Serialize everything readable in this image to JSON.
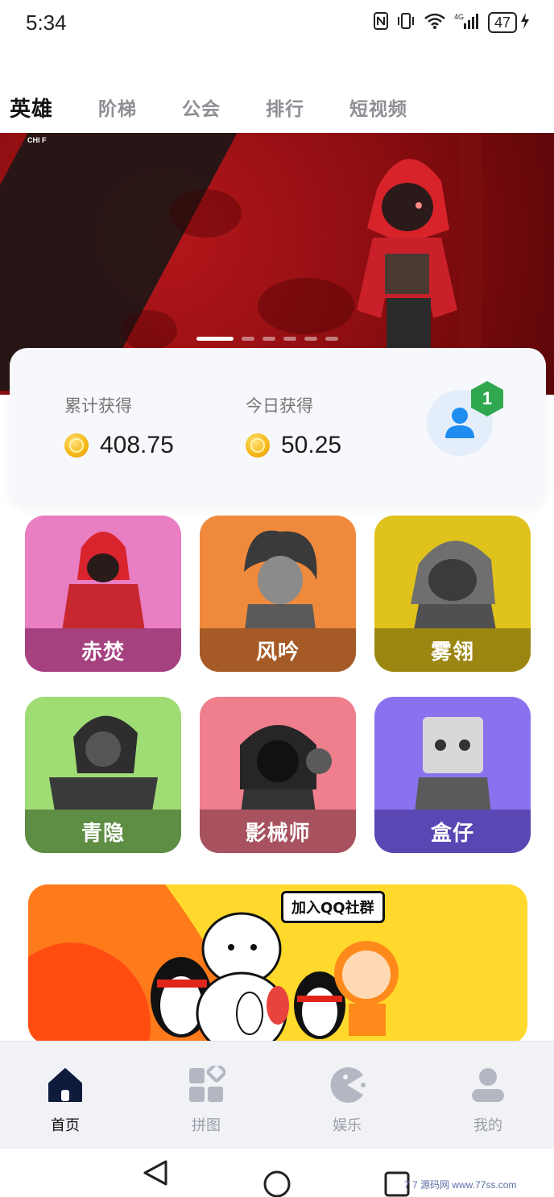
{
  "status_bar": {
    "time": "5:34",
    "battery": "47"
  },
  "top_tabs": [
    {
      "label": "英雄",
      "active": true
    },
    {
      "label": "阶梯",
      "active": false
    },
    {
      "label": "公会",
      "active": false
    },
    {
      "label": "排行",
      "active": false
    },
    {
      "label": "短视频",
      "active": false
    }
  ],
  "banner": {
    "corner_text": "CHI F",
    "slide_count": 6,
    "active_slide": 1
  },
  "earnings": {
    "total_label": "累计获得",
    "total_value": "408.75",
    "today_label": "今日获得",
    "today_value": "50.25",
    "badge_count": "1"
  },
  "heroes": [
    {
      "name": "赤焚",
      "bg": "#e97ec2",
      "bar": "#a6417f"
    },
    {
      "name": "风吟",
      "bg": "#ef8a3c",
      "bar": "#a65a26"
    },
    {
      "name": "雾翎",
      "bg": "#e0c21c",
      "bar": "#9c8612"
    },
    {
      "name": "青隐",
      "bg": "#9fdc74",
      "bar": "#5e8d44"
    },
    {
      "name": "影械师",
      "bg": "#ef7f8d",
      "bar": "#a7525e"
    },
    {
      "name": "盒仔",
      "bg": "#8a72ef",
      "bar": "#5b47b3"
    }
  ],
  "qq_banner": {
    "speech": "加入QQ社群"
  },
  "bottom_nav": [
    {
      "label": "首页",
      "icon": "home-icon",
      "active": true
    },
    {
      "label": "拼图",
      "icon": "puzzle-grid-icon",
      "active": false
    },
    {
      "label": "娱乐",
      "icon": "pacman-icon",
      "active": false
    },
    {
      "label": "我的",
      "icon": "profile-icon",
      "active": false
    }
  ],
  "watermark": "7 7 源码网 www.77ss.com",
  "colors": {
    "accent": "#1f8cf0",
    "badge": "#2fa84f",
    "nav_active": "#0f1b3d",
    "nav_inactive": "#b4b6c2"
  }
}
